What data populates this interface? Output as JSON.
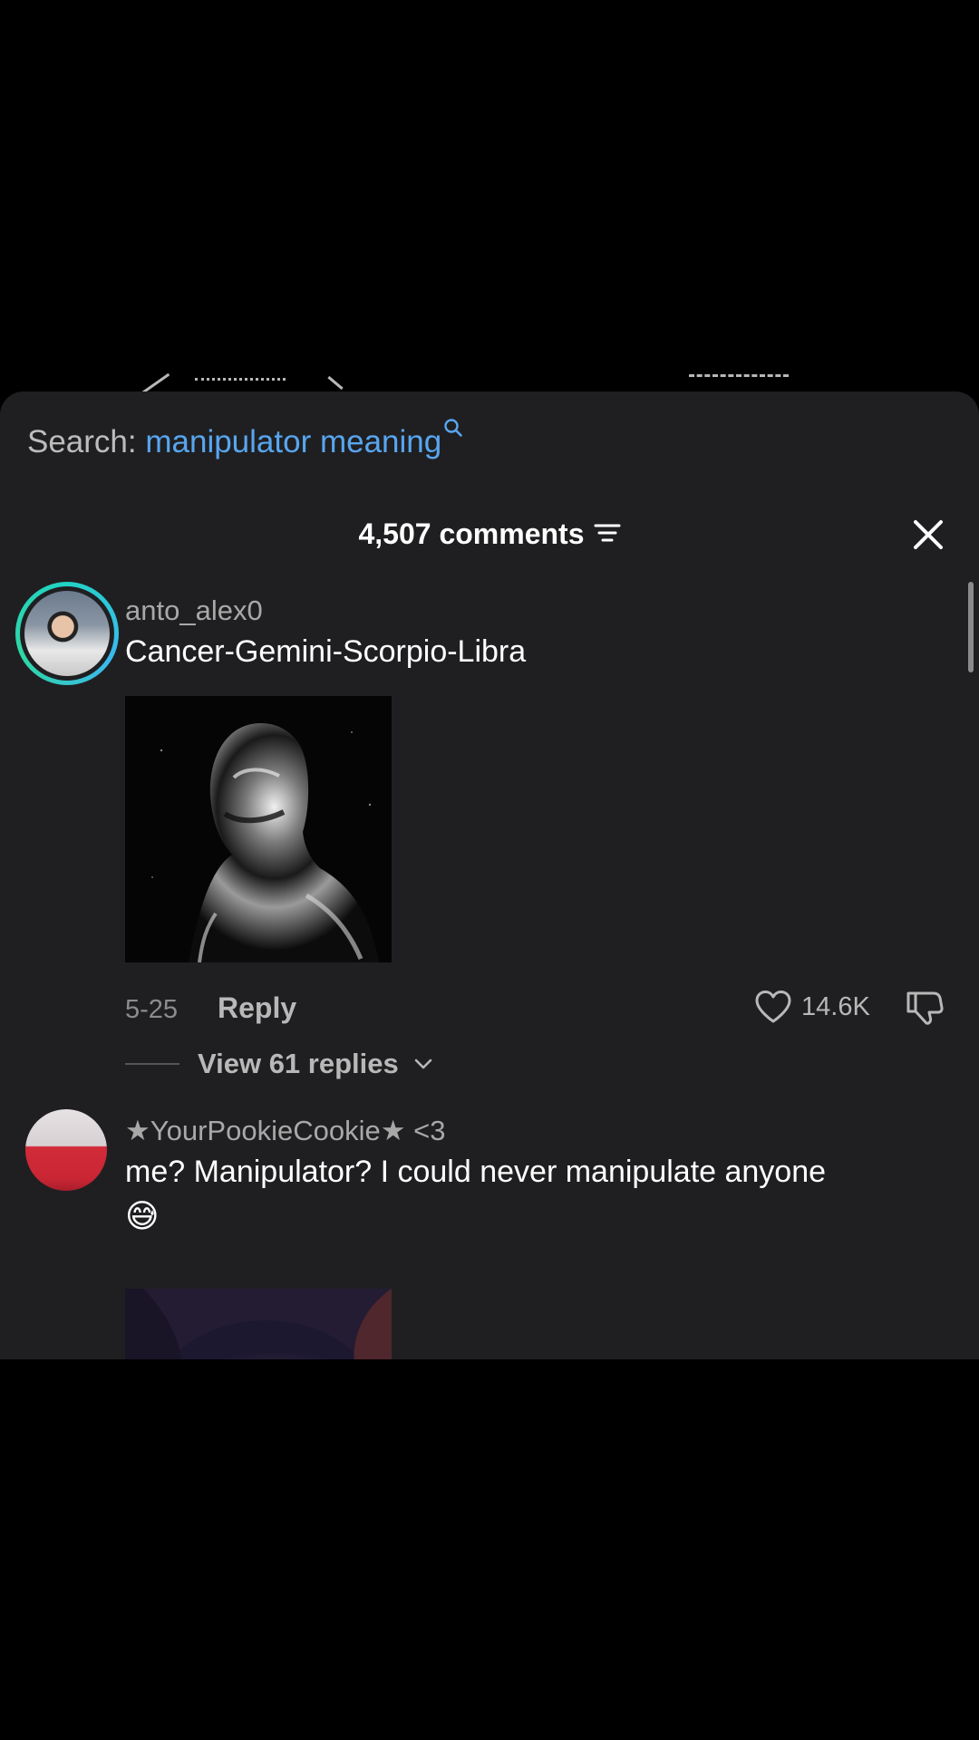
{
  "search": {
    "prefix": "Search:",
    "term": "manipulator meaning"
  },
  "header": {
    "comment_count": "4,507 comments"
  },
  "comments": [
    {
      "username": "anto_alex0",
      "text": "Cancer-Gemini-Scorpio-Libra",
      "date": "5-25",
      "reply_label": "Reply",
      "likes": "14.6K",
      "view_replies": "View 61 replies"
    },
    {
      "username": "★YourPookieCookie★ <3",
      "text": "me? Manipulator? I could never manipulate anyone",
      "emoji": "😅"
    }
  ],
  "colors": {
    "sheet_background": "#1f1f21",
    "search_term": "#58a6f0",
    "avatar_ring": "#22d3c5"
  },
  "icons": {
    "search": "search-icon",
    "sort": "sort-icon",
    "close": "close-icon",
    "heart": "heart-icon",
    "dislike": "thumbs-down-icon",
    "chevron": "chevron-down-icon"
  }
}
